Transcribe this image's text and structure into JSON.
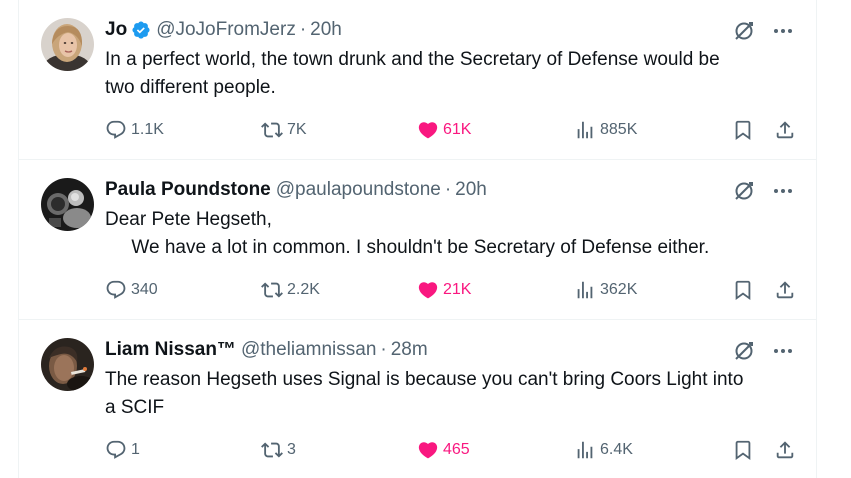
{
  "colors": {
    "text": "#0f1419",
    "muted": "#536471",
    "like": "#f91880",
    "verified": "#1d9bf0",
    "border": "#eff3f4"
  },
  "tweets": [
    {
      "name": "Jo",
      "verified": true,
      "handle": "@JoJoFromJerz",
      "separator": "·",
      "time": "20h",
      "text": "In a perfect world, the town drunk and the Secretary of Defense would be\ntwo different people.",
      "replies": "1.1K",
      "retweets": "7K",
      "likes": "61K",
      "views": "885K"
    },
    {
      "name": "Paula Poundstone",
      "verified": false,
      "handle": "@paulapoundstone",
      "separator": "·",
      "time": "20h",
      "text": "Dear Pete Hegseth,\n     We have a lot in common. I shouldn't be Secretary of Defense either.",
      "replies": "340",
      "retweets": "2.2K",
      "likes": "21K",
      "views": "362K"
    },
    {
      "name": "Liam Nissan™",
      "verified": false,
      "handle": "@theliamnissan",
      "separator": "·",
      "time": "28m",
      "text": "The reason Hegseth uses Signal is because you can't bring Coors Light into\na SCIF",
      "replies": "1",
      "retweets": "3",
      "likes": "465",
      "views": "6.4K"
    }
  ],
  "icons": {
    "reply": "reply-icon",
    "retweet": "retweet-icon",
    "like": "heart-filled-icon",
    "views": "views-chart-icon",
    "bookmark": "bookmark-icon",
    "share": "share-icon",
    "grok": "grok-icon",
    "more": "more-icon",
    "verified": "verified-badge-icon"
  }
}
